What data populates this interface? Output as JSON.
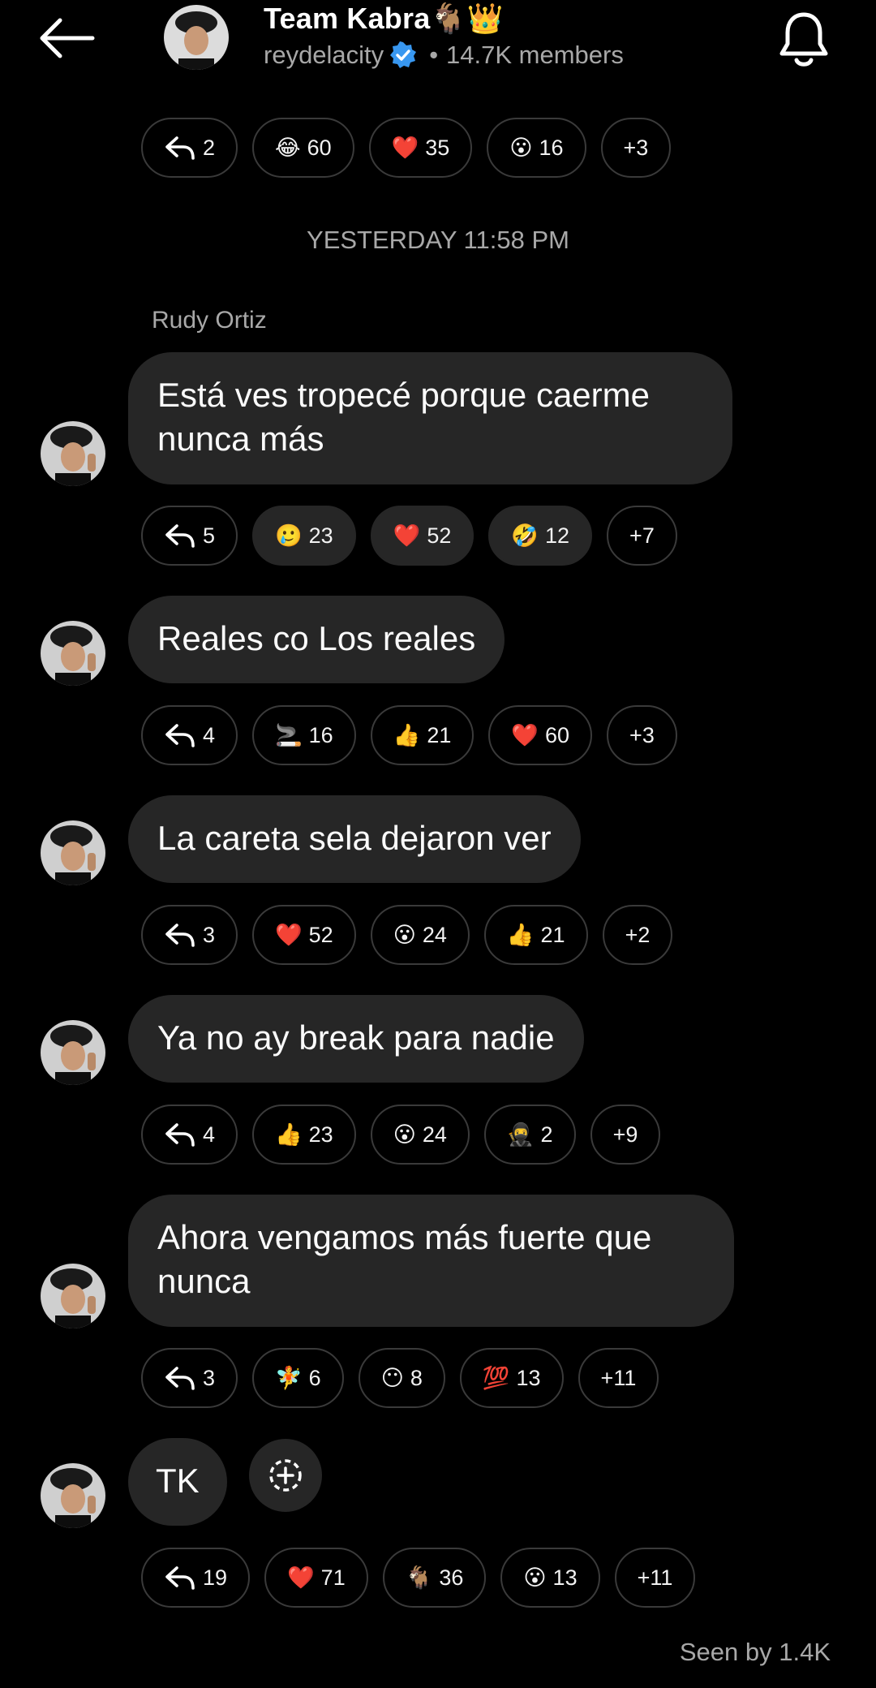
{
  "header": {
    "title": "Team Kabra🐐👑",
    "username": "reydelacity",
    "members": "14.7K members"
  },
  "timestamp": "YESTERDAY 11:58 PM",
  "sender": "Rudy Ortiz",
  "top_reactions": [
    {
      "icon": "reply-icon",
      "count": "2"
    },
    {
      "emoji": "😂",
      "count": "60"
    },
    {
      "emoji": "❤️",
      "count": "35"
    },
    {
      "emoji": "😮",
      "count": "16"
    },
    {
      "more": "+3"
    }
  ],
  "messages": [
    {
      "text": "Está ves tropecé porque caerme nunca más",
      "reactions": [
        {
          "icon": "reply-icon",
          "count": "5"
        },
        {
          "emoji": "🥲",
          "count": "23",
          "filled": true
        },
        {
          "emoji": "❤️",
          "count": "52",
          "filled": true
        },
        {
          "emoji": "🤣",
          "count": "12",
          "filled": true
        },
        {
          "more": "+7"
        }
      ]
    },
    {
      "text": "Reales co Los reales",
      "reactions": [
        {
          "icon": "reply-icon",
          "count": "4"
        },
        {
          "emoji": "🚬",
          "count": "16"
        },
        {
          "emoji": "👍",
          "count": "21"
        },
        {
          "emoji": "❤️",
          "count": "60"
        },
        {
          "more": "+3"
        }
      ]
    },
    {
      "text": "La careta sela dejaron ver",
      "reactions": [
        {
          "icon": "reply-icon",
          "count": "3"
        },
        {
          "emoji": "❤️",
          "count": "52"
        },
        {
          "emoji": "😮",
          "count": "24"
        },
        {
          "emoji": "👍",
          "count": "21"
        },
        {
          "more": "+2"
        }
      ]
    },
    {
      "text": "Ya no ay break para nadie",
      "reactions": [
        {
          "icon": "reply-icon",
          "count": "4"
        },
        {
          "emoji": "👍",
          "count": "23"
        },
        {
          "emoji": "😮",
          "count": "24"
        },
        {
          "emoji": "🥷",
          "count": "2"
        },
        {
          "more": "+9"
        }
      ]
    },
    {
      "text": "Ahora vengamos más fuerte que nunca",
      "reactions": [
        {
          "icon": "reply-icon",
          "count": "3"
        },
        {
          "emoji": "🧚",
          "count": "6"
        },
        {
          "emoji": "😶",
          "count": "8"
        },
        {
          "emoji": "💯",
          "count": "13"
        },
        {
          "more": "+11"
        }
      ]
    },
    {
      "text": "TK",
      "reactions": [
        {
          "icon": "reply-icon",
          "count": "19"
        },
        {
          "emoji": "❤️",
          "count": "71"
        },
        {
          "emoji": "🐐",
          "count": "36"
        },
        {
          "emoji": "😮",
          "count": "13"
        },
        {
          "more": "+11"
        }
      ]
    }
  ],
  "seen": "Seen by 1.4K",
  "colors": {
    "background": "#000000",
    "bubble": "#262626",
    "muted": "#a8a8a8",
    "verified": "#3897f0"
  }
}
